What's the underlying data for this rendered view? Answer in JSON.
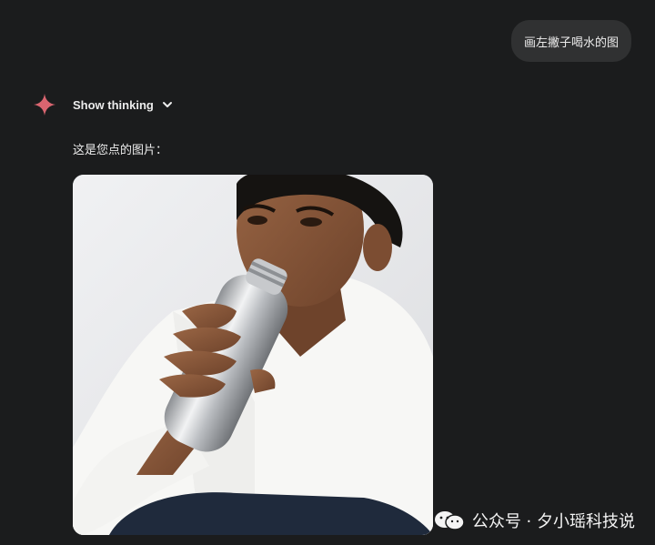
{
  "conversation": {
    "user_message": "画左撇子喝水的图",
    "assistant": {
      "thinking_label": "Show thinking",
      "reply_text": "这是您点的图片：",
      "image": {
        "subject": "man drinking from a stainless steel water bottle"
      }
    }
  },
  "watermark": {
    "text": "公众号 · 夕小瑶科技说",
    "icon": "wechat-icon"
  },
  "colors": {
    "background": "#1b1c1d",
    "bubble": "#303132",
    "spark": "#d96570",
    "text": "#ececec"
  }
}
